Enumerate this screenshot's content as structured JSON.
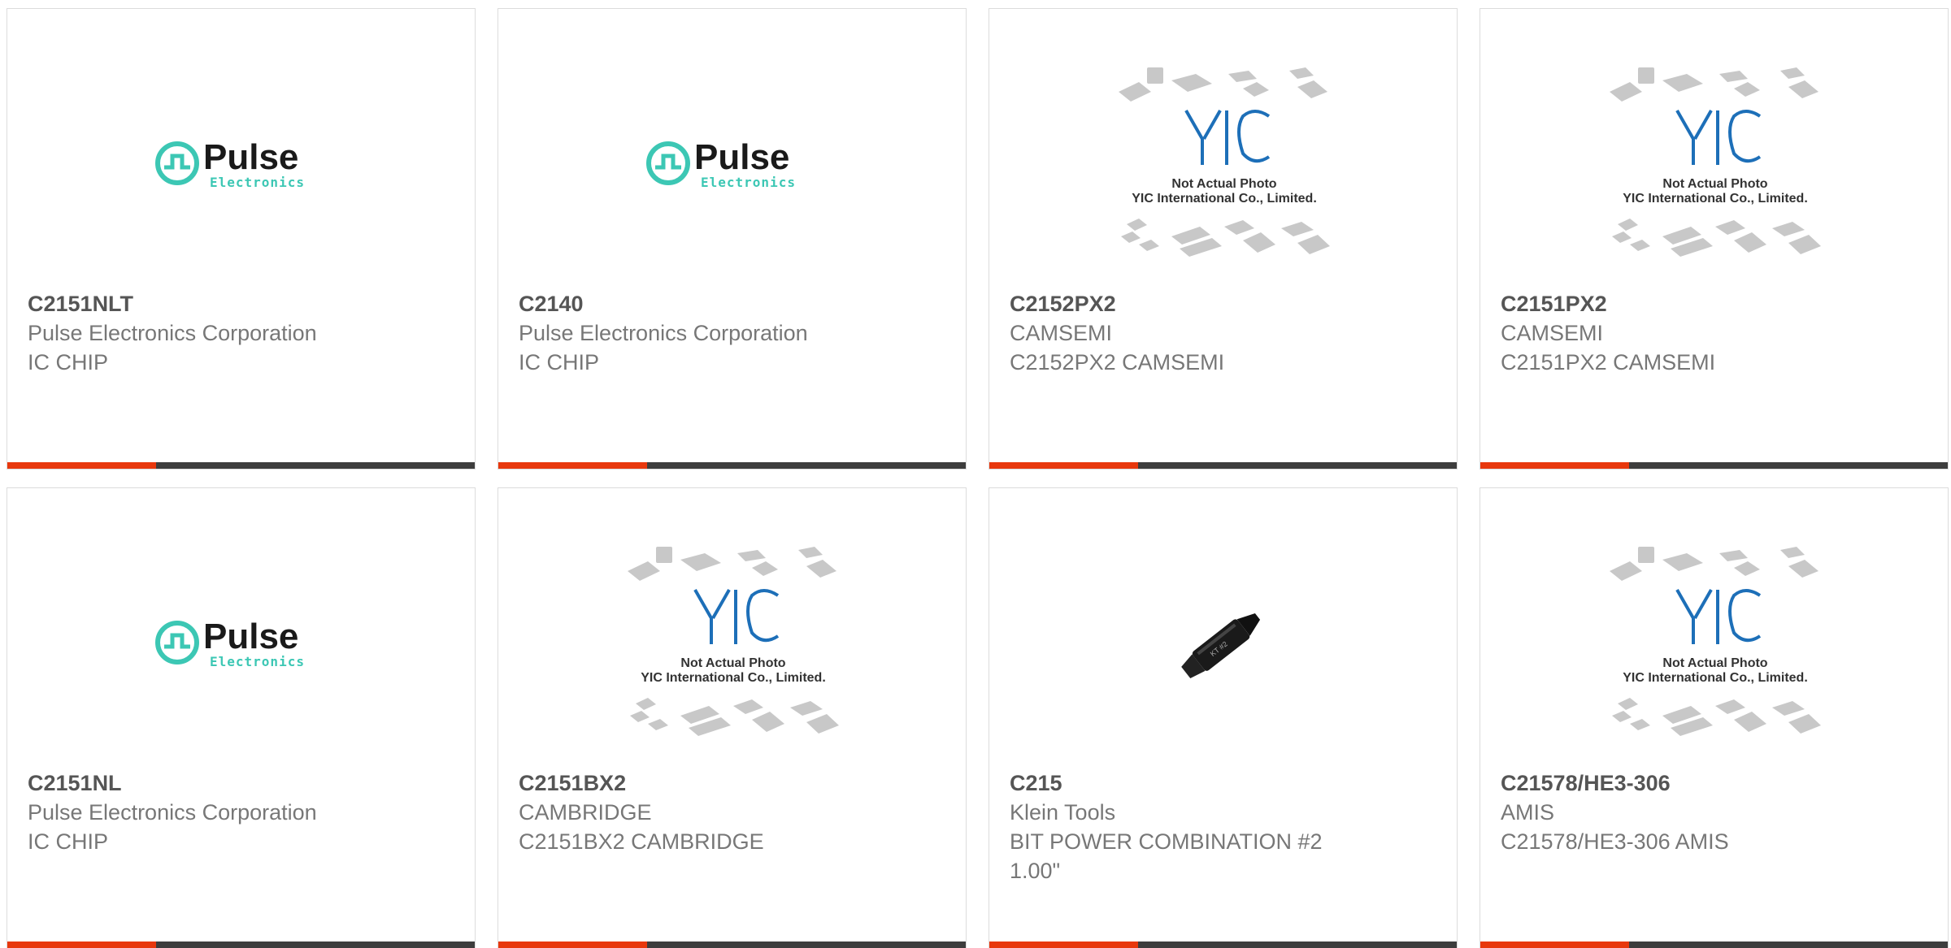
{
  "products": [
    {
      "part_number": "C2151NLT",
      "manufacturer": "Pulse Electronics Corporation",
      "description": "IC CHIP",
      "image": "pulse-logo"
    },
    {
      "part_number": "C2140",
      "manufacturer": "Pulse Electronics Corporation",
      "description": "IC CHIP",
      "image": "pulse-logo"
    },
    {
      "part_number": "C2152PX2",
      "manufacturer": "CAMSEMI",
      "description": "C2152PX2 CAMSEMI",
      "image": "yic-placeholder"
    },
    {
      "part_number": "C2151PX2",
      "manufacturer": "CAMSEMI",
      "description": "C2151PX2 CAMSEMI",
      "image": "yic-placeholder"
    },
    {
      "part_number": "C2151NL",
      "manufacturer": "Pulse Electronics Corporation",
      "description": "IC CHIP",
      "image": "pulse-logo"
    },
    {
      "part_number": "C2151BX2",
      "manufacturer": "CAMBRIDGE",
      "description": "C2151BX2 CAMBRIDGE",
      "image": "yic-placeholder"
    },
    {
      "part_number": "C215",
      "manufacturer": "Klein Tools",
      "description": "BIT POWER COMBINATION #2 1.00\"",
      "image": "screwdriver-bit"
    },
    {
      "part_number": "C21578/HE3-306",
      "manufacturer": "AMIS",
      "description": "C21578/HE3-306 AMIS",
      "image": "yic-placeholder"
    }
  ],
  "logo_text": {
    "pulse_main": "Pulse",
    "pulse_sub": "Electronics",
    "yic_line1": "Not Actual Photo",
    "yic_line2": "YIC International Co., Limited."
  },
  "colors": {
    "accent": "#e8380d",
    "bar": "#3d3d3d",
    "pulse_teal": "#3cc7b4",
    "yic_blue": "#1d6fb8"
  }
}
